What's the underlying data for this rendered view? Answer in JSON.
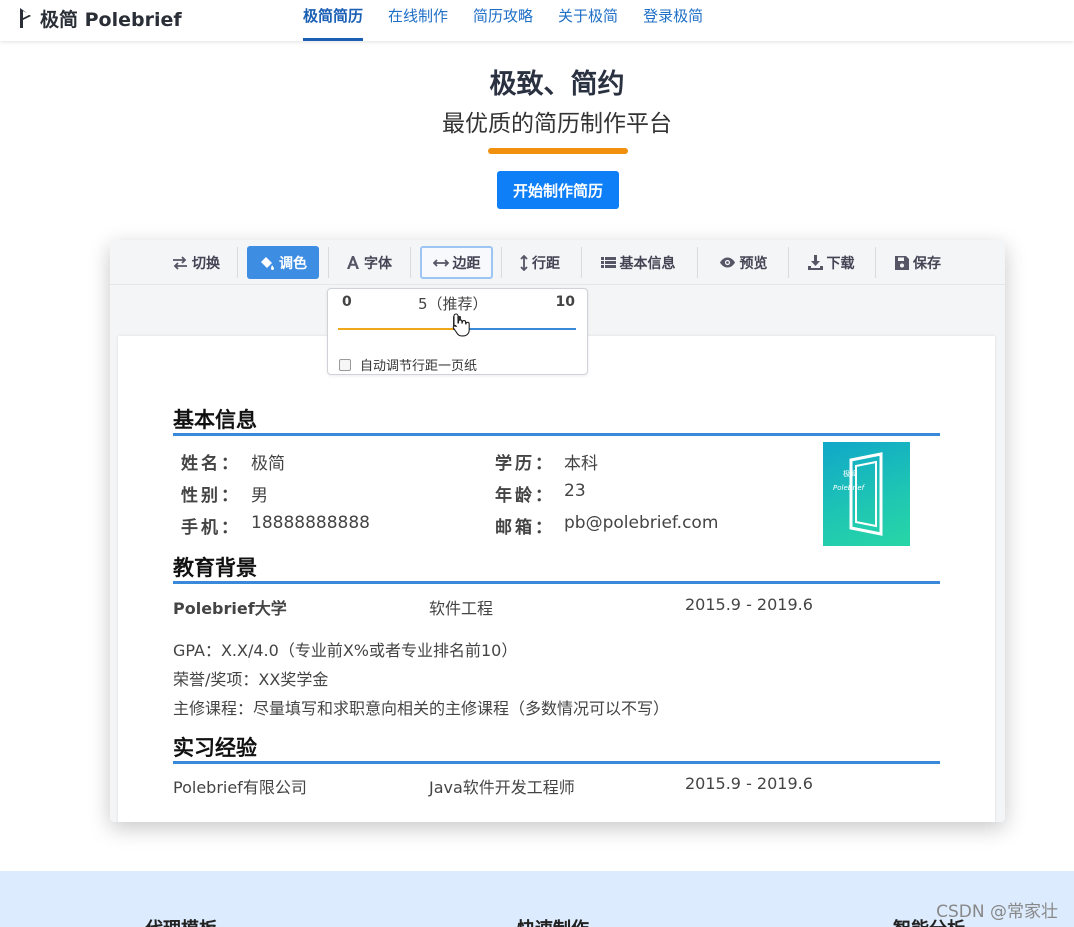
{
  "nav": {
    "brand": "极简 Polebrief",
    "items": [
      {
        "label": "极简简历",
        "active": true
      },
      {
        "label": "在线制作",
        "active": false
      },
      {
        "label": "简历攻略",
        "active": false
      },
      {
        "label": "关于极简",
        "active": false
      },
      {
        "label": "登录极简",
        "active": false
      }
    ]
  },
  "hero": {
    "title": "极致、简约",
    "subtitle": "最优质的简历制作平台",
    "cta_label": "开始制作简历",
    "accent_color": "#f0900e",
    "cta_color": "#0e7ff7"
  },
  "toolbar": {
    "items": [
      {
        "label": "切换",
        "icon": "swap-icon"
      },
      {
        "label": "调色",
        "icon": "paint-bucket-icon",
        "active": true
      },
      {
        "label": "字体",
        "icon": "font-icon"
      },
      {
        "label": "边距",
        "icon": "horizontal-arrows-icon",
        "focused": true
      },
      {
        "label": "行距",
        "icon": "vertical-arrows-icon"
      },
      {
        "label": "基本信息",
        "icon": "list-icon"
      },
      {
        "label": "预览",
        "icon": "eye-icon"
      },
      {
        "label": "下载",
        "icon": "download-icon"
      },
      {
        "label": "保存",
        "icon": "save-icon"
      }
    ]
  },
  "margin_popover": {
    "min": "0",
    "current": "5（推荐）",
    "max": "10",
    "value_fraction": 0.5,
    "checkbox_label": "自动调节行距一页纸",
    "checked": false
  },
  "resume": {
    "basic_title": "基本信息",
    "fields": [
      {
        "key": "姓名：",
        "value": "极简"
      },
      {
        "key": "性别：",
        "value": "男"
      },
      {
        "key": "手机：",
        "value": "18888888888"
      },
      {
        "key": "学历：",
        "value": "本科"
      },
      {
        "key": "年龄：",
        "value": "23"
      },
      {
        "key": "邮箱：",
        "value": "pb@polebrief.com"
      }
    ],
    "photo_text": "极简\nPoleBrief",
    "education_title": "教育背景",
    "education": {
      "school": "Polebrief大学",
      "major": "软件工程",
      "period": "2015.9 - 2019.6",
      "lines": [
        "GPA：X.X/4.0（专业前X%或者专业排名前10）",
        "荣誉/奖项：XX奖学金",
        "主修课程：尽量填写和求职意向相关的主修课程（多数情况可以不写）"
      ]
    },
    "intern_title": "实习经验",
    "intern": {
      "company": "Polebrief有限公司",
      "role": "Java软件开发工程师",
      "period": "2015.9 - 2019.6"
    },
    "line_color": "#3a88d8"
  },
  "bottom": {
    "headings": [
      "代理模板",
      "快速制作",
      "智能分析"
    ]
  },
  "watermark": "CSDN @常家壮"
}
